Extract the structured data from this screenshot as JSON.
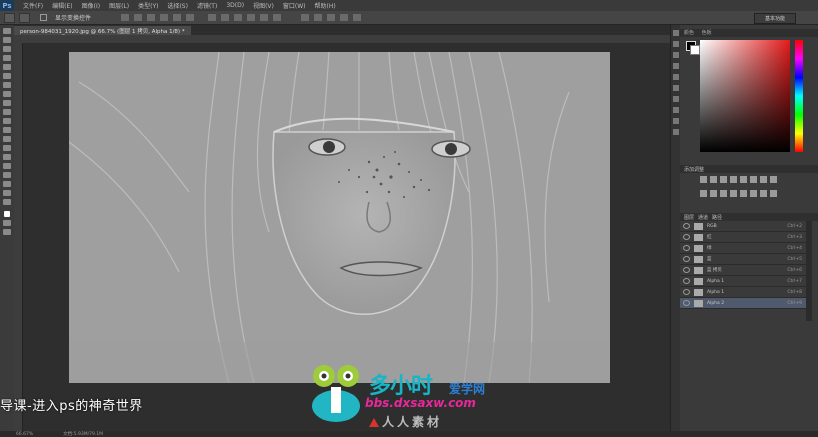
{
  "app": {
    "logo": "Ps"
  },
  "menubar": {
    "items": [
      "文件(F)",
      "编辑(E)",
      "图像(I)",
      "图层(L)",
      "类型(Y)",
      "选择(S)",
      "滤镜(T)",
      "3D(D)",
      "视图(V)",
      "窗口(W)",
      "帮助(H)"
    ]
  },
  "optionsbar": {
    "show_transform_label": "显示变换控件",
    "workspace": "基本功能"
  },
  "document": {
    "tab_title": "person-984031_1920.jpg @ 66.7% (图层 1 拷贝, Alpha 1/8) *"
  },
  "color_panel": {
    "tabs": [
      "颜色",
      "色板"
    ],
    "fg": "#000000",
    "bg": "#ffffff"
  },
  "adjustments_panel": {
    "header": "添加调整"
  },
  "channels_panel": {
    "tabs": [
      "图层",
      "通道",
      "路径"
    ],
    "rows": [
      {
        "name": "RGB",
        "shortcut": "Ctrl+2",
        "selected": false
      },
      {
        "name": "红",
        "shortcut": "Ctrl+3",
        "selected": false
      },
      {
        "name": "绿",
        "shortcut": "Ctrl+4",
        "selected": false
      },
      {
        "name": "蓝",
        "shortcut": "Ctrl+5",
        "selected": false
      },
      {
        "name": "蓝 拷贝",
        "shortcut": "Ctrl+6",
        "selected": false
      },
      {
        "name": "Alpha 1",
        "shortcut": "Ctrl+7",
        "selected": false
      },
      {
        "name": "Alpha 1",
        "shortcut": "Ctrl+8",
        "selected": false
      },
      {
        "name": "Alpha 2",
        "shortcut": "Ctrl+9",
        "selected": true
      }
    ]
  },
  "statusbar": {
    "zoom": "66.67%",
    "doc_info": "文档:5.93M/79.1M"
  },
  "overlay": {
    "subtitle": "导课-进入ps的神奇世界",
    "watermark_brand": "多小时",
    "watermark_tag": "爱学网",
    "watermark_url": "bbs.dxsaxw.com",
    "watermark_rr": "人人素材"
  }
}
